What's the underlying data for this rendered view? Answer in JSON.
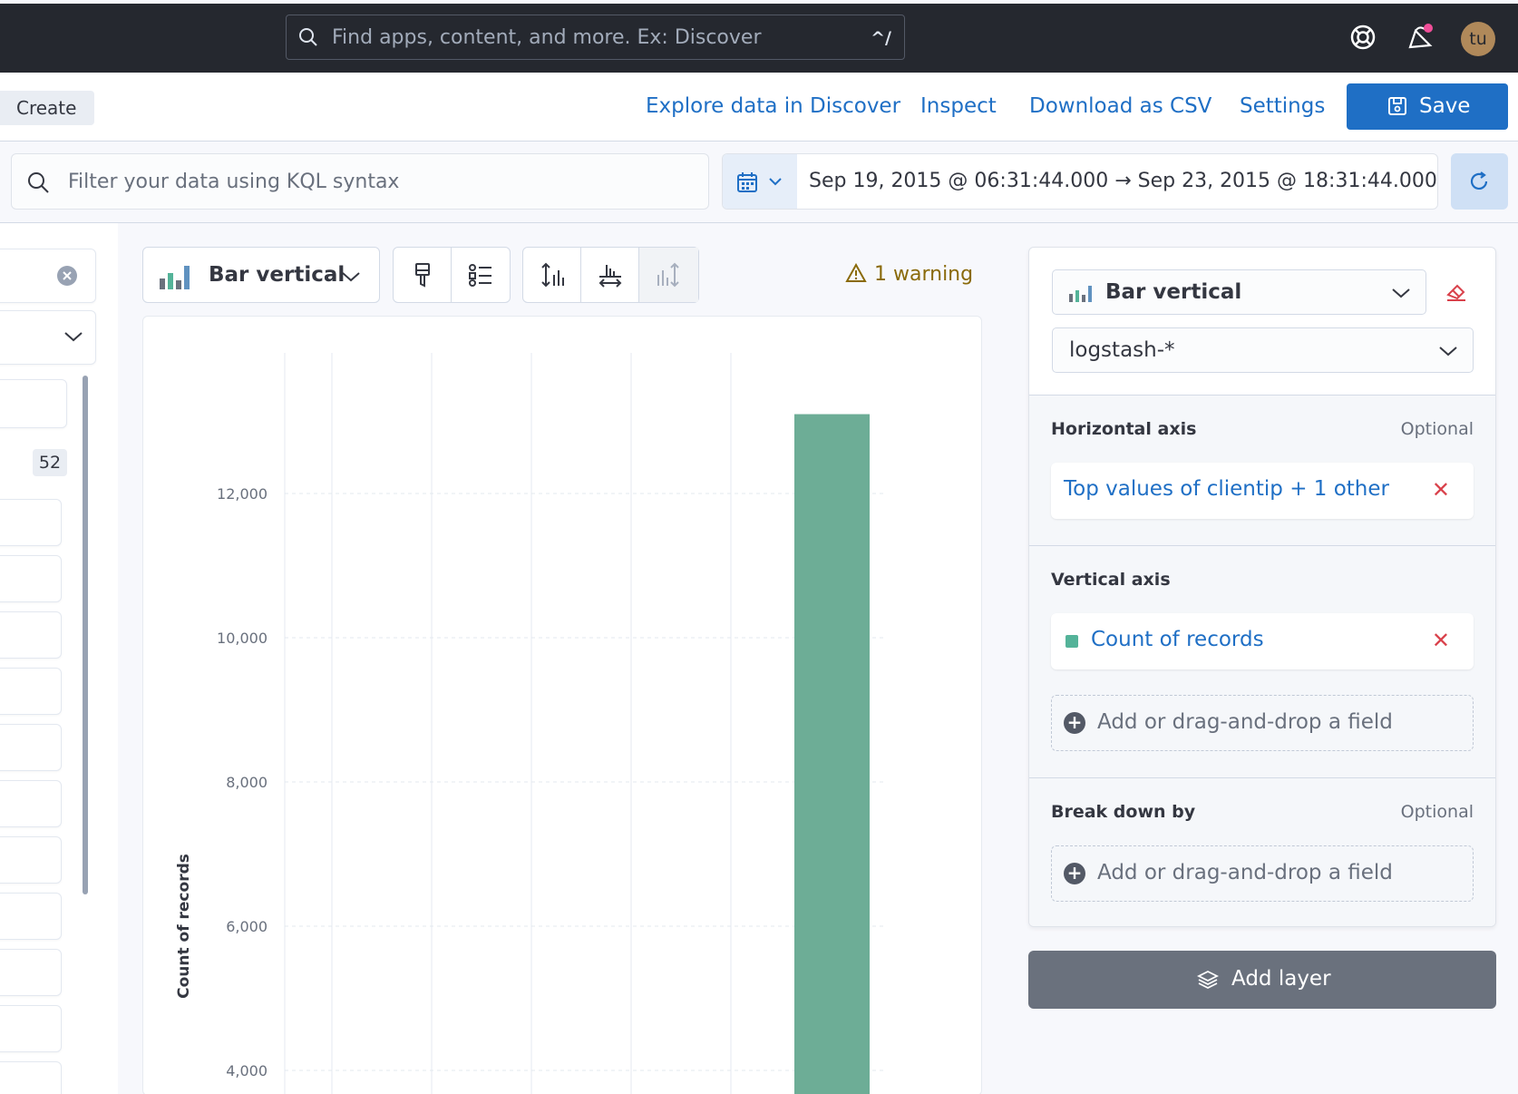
{
  "topbar": {
    "search_placeholder": "Find apps, content, and more. Ex: Discover",
    "search_shortcut": "^/",
    "avatar_initials": "tu",
    "icons": [
      "search-icon",
      "help-icon",
      "newsfeed-icon",
      "avatar"
    ]
  },
  "header": {
    "breadcrumb": "Create",
    "links": {
      "explore": "Explore data in Discover",
      "inspect": "Inspect",
      "download": "Download as CSV",
      "settings": "Settings"
    },
    "save_label": "Save"
  },
  "filter": {
    "kql_placeholder": "Filter your data using KQL syntax",
    "date_range": "Sep 19, 2015 @ 06:31:44.000 → Sep 23, 2015 @ 18:31:44.000"
  },
  "left_panel": {
    "badge_count": "52"
  },
  "workspace": {
    "chart_type_label": "Bar vertical",
    "warning_label": "1 warning"
  },
  "chart_data": {
    "type": "bar",
    "ylabel": "Count of records",
    "yticks": [
      "12,000",
      "10,000",
      "8,000",
      "6,000",
      "4,000"
    ],
    "ylim": [
      4000,
      13100
    ],
    "values": [
      13100
    ],
    "bar_color": "#6dad96",
    "grid": true
  },
  "config": {
    "vis_type": "Bar vertical",
    "index_pattern": "logstash-*",
    "horizontal_axis": {
      "title": "Horizontal axis",
      "optional": "Optional",
      "dimension": "Top values of clientip + 1 other"
    },
    "vertical_axis": {
      "title": "Vertical axis",
      "dimension": "Count of records",
      "add_field": "Add or drag-and-drop a field"
    },
    "breakdown": {
      "title": "Break down by",
      "optional": "Optional",
      "add_field": "Add or drag-and-drop a field"
    },
    "add_layer": "Add layer"
  },
  "colors": {
    "primary": "#1f6fc5",
    "dark_header": "#25282f",
    "danger": "#d9414b",
    "warning": "#8a6a0a",
    "bar": "#6dad96"
  }
}
